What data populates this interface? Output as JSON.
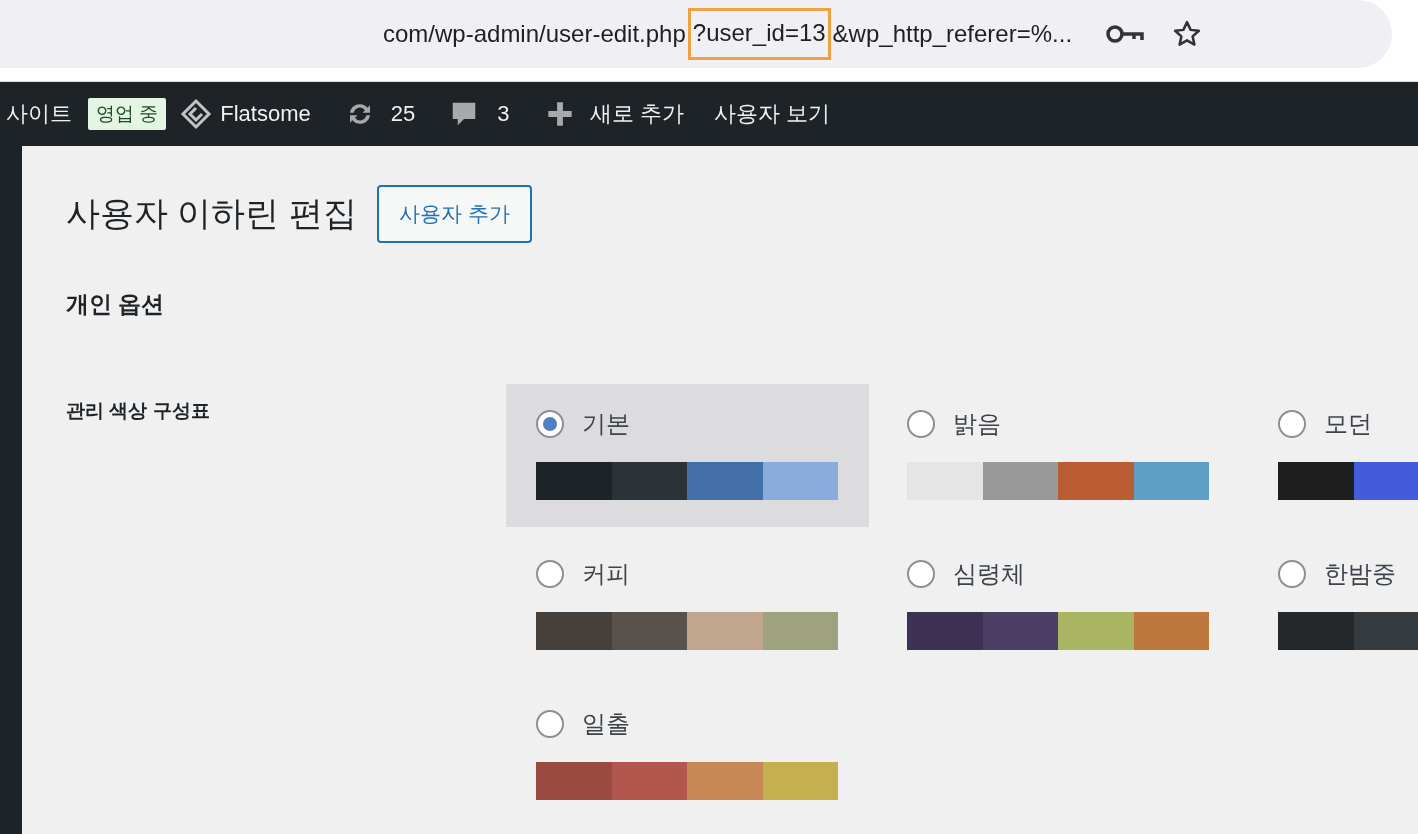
{
  "address_bar": {
    "url_before": "com/wp-admin/user-edit.php",
    "url_highlight": "?user_id=13",
    "url_after": "&wp_http_referer=%..."
  },
  "admin_bar": {
    "site": "사이트",
    "status_badge": "영업 중",
    "theme": "Flatsome",
    "updates": "25",
    "comments": "3",
    "new": "새로 추가",
    "view_user": "사용자 보기"
  },
  "page": {
    "title": "사용자 이하린 편집",
    "add_button": "사용자 추가",
    "section_title": "개인 옵션",
    "field_label": "관리 색상 구성표"
  },
  "color_schemes": [
    {
      "label": "기본",
      "selected": true,
      "swatches": [
        {
          "color": "#1d2327"
        },
        {
          "color": "#2c3338"
        },
        {
          "color": "#4470aa"
        },
        {
          "color": "#8aacdd"
        }
      ]
    },
    {
      "label": "밝음",
      "selected": false,
      "swatches": [
        {
          "color": "#e5e5e5"
        },
        {
          "color": "#999999"
        },
        {
          "color": "#ba5d33"
        },
        {
          "color": "#609fc5"
        }
      ]
    },
    {
      "label": "모던",
      "selected": false,
      "swatches": [
        {
          "color": "#1e1e1e"
        },
        {
          "color": "#435cdc"
        }
      ]
    },
    {
      "label": "커피",
      "selected": false,
      "swatches": [
        {
          "color": "#46403c"
        },
        {
          "color": "#59524c"
        },
        {
          "color": "#c0a68f"
        },
        {
          "color": "#9ea27e"
        }
      ]
    },
    {
      "label": "심령체",
      "selected": false,
      "swatches": [
        {
          "color": "#3d3253"
        },
        {
          "color": "#4c3f66"
        },
        {
          "color": "#a9b562"
        },
        {
          "color": "#be773c"
        }
      ]
    },
    {
      "label": "한밤중",
      "selected": false,
      "swatches": [
        {
          "color": "#25282b"
        },
        {
          "color": "#363b3f"
        }
      ]
    },
    {
      "label": "일출",
      "selected": false,
      "swatches": [
        {
          "color": "#9a4a41"
        },
        {
          "color": "#b2574d"
        },
        {
          "color": "#c88855"
        },
        {
          "color": "#c5b04f"
        }
      ]
    }
  ]
}
